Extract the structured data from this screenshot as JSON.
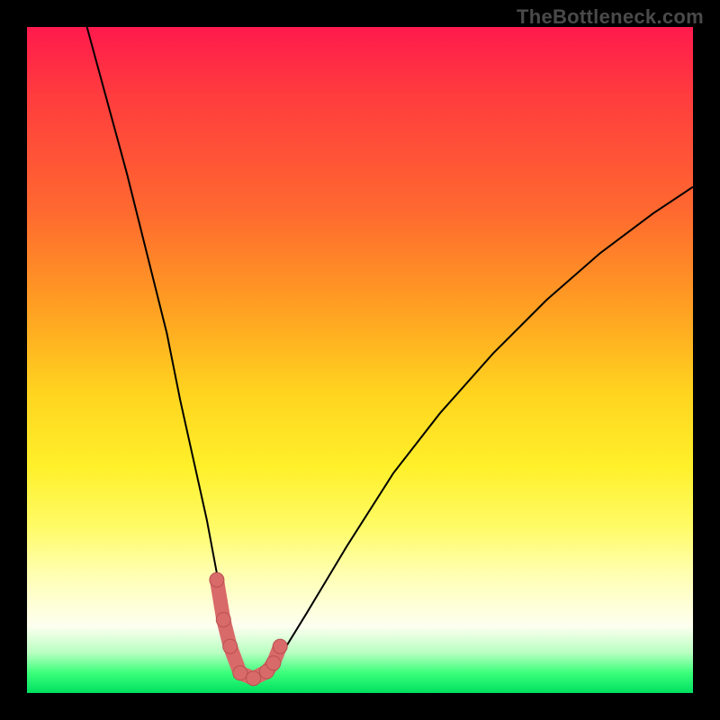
{
  "branding": "TheBottleneck.com",
  "colors": {
    "curve": "#000000",
    "marker": "#d96a6a",
    "marker_stroke": "#b85050",
    "gradient_top": "#ff1a4d",
    "gradient_bottom": "#00e060"
  },
  "chart_data": {
    "type": "line",
    "title": "",
    "xlabel": "",
    "ylabel": "",
    "xlim": [
      0,
      100
    ],
    "ylim": [
      0,
      100
    ],
    "grid": false,
    "legend": false,
    "series": [
      {
        "name": "bottleneck-curve",
        "x": [
          9,
          12,
          15,
          18,
          21,
          23,
          25,
          27,
          28.5,
          30,
          31,
          32,
          33,
          34,
          35,
          36,
          38,
          42,
          48,
          55,
          62,
          70,
          78,
          86,
          94,
          100
        ],
        "y": [
          100,
          89,
          78,
          66,
          54,
          44,
          35,
          26,
          18,
          11,
          6.5,
          3.5,
          2.2,
          2.0,
          2.2,
          3.0,
          5.5,
          12,
          22,
          33,
          42,
          51,
          59,
          66,
          72,
          76
        ]
      }
    ],
    "markers": {
      "name": "highlight-dots",
      "color": "#d96a6a",
      "radius": 8,
      "x": [
        28.5,
        29.5,
        30.5,
        32,
        34,
        36,
        37,
        38
      ],
      "y": [
        17,
        11,
        7,
        3,
        2.2,
        3.2,
        4.5,
        7
      ]
    }
  }
}
